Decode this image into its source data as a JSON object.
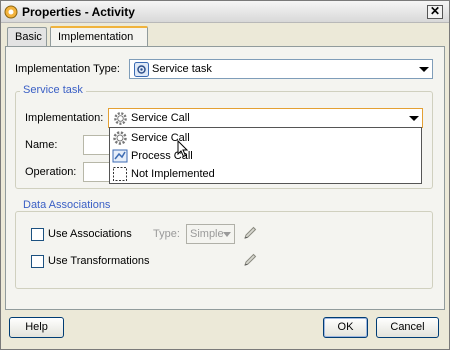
{
  "window": {
    "title": "Properties - Activity",
    "close_glyph": "✕"
  },
  "tabs": [
    {
      "label": "Basic",
      "active": false
    },
    {
      "label": "Implementation",
      "active": true
    }
  ],
  "implementation_type": {
    "label": "Implementation Type:",
    "value": "Service task",
    "icon": "service-task-icon"
  },
  "service_task_group": {
    "title": "Service task",
    "implementation": {
      "label": "Implementation:",
      "value": "Service Call",
      "icon": "gear-icon"
    },
    "name_label": "Name:",
    "operation_label": "Operation:",
    "dropdown_options": [
      {
        "label": "Service Call",
        "icon": "gear-icon",
        "highlighted": true
      },
      {
        "label": "Process Call",
        "icon": "process-icon",
        "highlighted": false
      },
      {
        "label": "Not Implemented",
        "icon": "dashed-box-icon",
        "highlighted": false
      }
    ]
  },
  "data_associations": {
    "title": "Data Associations",
    "use_associations_label": "Use Associations",
    "type_label": "Type:",
    "type_value": "Simple",
    "use_transformations_label": "Use Transformations"
  },
  "buttons": {
    "help": "Help",
    "ok": "OK",
    "cancel": "Cancel"
  },
  "colors": {
    "group_title": "#3a5fc5",
    "tab_accent": "#f0b33c",
    "panel_bg": "#f4f4f0"
  }
}
